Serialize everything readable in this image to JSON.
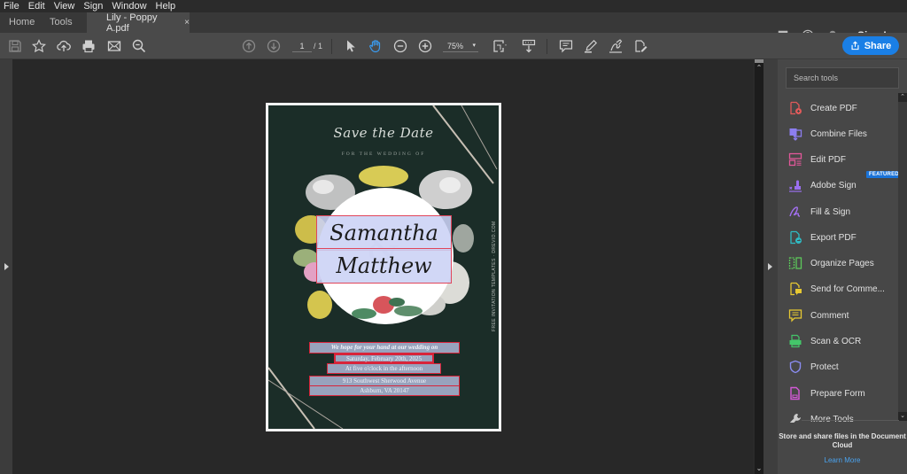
{
  "menu": [
    "File",
    "Edit",
    "View",
    "Sign",
    "Window",
    "Help"
  ],
  "tabs": {
    "home": "Home",
    "tools": "Tools",
    "document": "Lily - Poppy A.pdf",
    "close_glyph": "×"
  },
  "header_right": {
    "sign_in": "Sign In"
  },
  "toolbar": {
    "current_page": "1",
    "total_pages": "/ 1",
    "zoom_level": "75%",
    "share_label": "Share"
  },
  "tools_panel": {
    "search_placeholder": "Search tools",
    "items": [
      {
        "label": "Create PDF",
        "icon": "create-pdf-icon",
        "color": "#e05a5a"
      },
      {
        "label": "Combine Files",
        "icon": "combine-files-icon",
        "color": "#8c7ef0"
      },
      {
        "label": "Edit PDF",
        "icon": "edit-pdf-icon",
        "color": "#e2589a"
      },
      {
        "label": "Adobe Sign",
        "icon": "adobe-sign-icon",
        "color": "#9b6ff0",
        "badge": "FEATURED"
      },
      {
        "label": "Fill & Sign",
        "icon": "fill-sign-icon",
        "color": "#a470f2"
      },
      {
        "label": "Export PDF",
        "icon": "export-pdf-icon",
        "color": "#2fbac3"
      },
      {
        "label": "Organize Pages",
        "icon": "organize-pages-icon",
        "color": "#5cc75a"
      },
      {
        "label": "Send for Comme...",
        "icon": "send-for-comment-icon",
        "color": "#e6c832"
      },
      {
        "label": "Comment",
        "icon": "comment-icon",
        "color": "#e6c832"
      },
      {
        "label": "Scan & OCR",
        "icon": "scan-ocr-icon",
        "color": "#44c76a"
      },
      {
        "label": "Protect",
        "icon": "protect-icon",
        "color": "#8a8cf0"
      },
      {
        "label": "Prepare Form",
        "icon": "prepare-form-icon",
        "color": "#d45ad8"
      },
      {
        "label": "More Tools",
        "icon": "more-tools-icon",
        "color": "#cccccc"
      }
    ],
    "cloud_text": "Store and share files in the Document Cloud",
    "learn_more": "Learn More"
  },
  "document": {
    "heading": "Save the Date",
    "subheading": "FOR THE WEDDING OF",
    "name_1": "Samantha",
    "name_2": "Matthew",
    "side_text": "FREE INVITATION TEMPLATES · DREVIO.COM",
    "line_1": "We hope for your hand at our wedding on",
    "date": "Saturday, February 20th, 2025",
    "time": "At five o'clock in the afternoon",
    "address_1": "913 Southwest Sherwood Avenue",
    "address_2": "Ashburn, VA 20147"
  },
  "colors": {
    "accent": "#1a7fe6",
    "page_background": "#1b2d28",
    "field_border": "#e0455a"
  }
}
